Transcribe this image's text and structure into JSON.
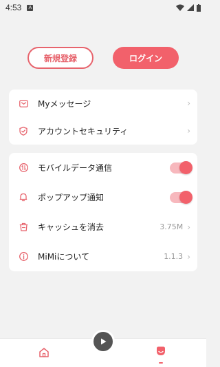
{
  "status_bar": {
    "time": "4:53"
  },
  "auth": {
    "register_label": "新規登録",
    "login_label": "ログイン"
  },
  "menu_group1": [
    {
      "label": "Myメッセージ",
      "icon": "mail-icon"
    },
    {
      "label": "アカウントセキュリティ",
      "icon": "shield-icon"
    }
  ],
  "menu_group2": [
    {
      "label": "モバイルデータ通信",
      "icon": "data-icon",
      "toggle": true,
      "on": true
    },
    {
      "label": "ポップアップ通知",
      "icon": "bell-icon",
      "toggle": true,
      "on": true
    },
    {
      "label": "キャッシュを消去",
      "icon": "trash-icon",
      "value": "3.75M"
    },
    {
      "label": "MiMiについて",
      "icon": "info-icon",
      "value": "1.1.3"
    }
  ],
  "colors": {
    "accent": "#f2616b",
    "background": "#f2f2f2"
  }
}
